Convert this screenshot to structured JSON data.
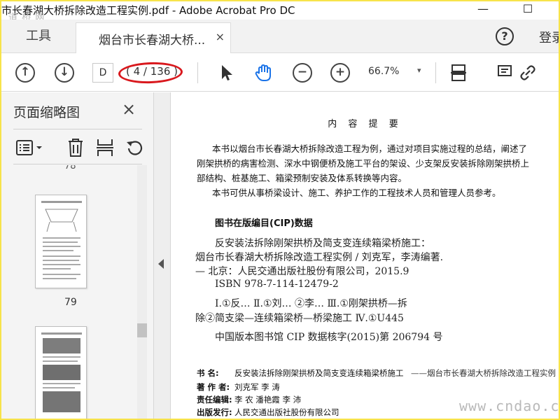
{
  "window": {
    "title": "市长春湖大桥拆除改造工程实例.pdf - Adobe Acrobat Pro DC",
    "watermark_top": "道 桥 网",
    "minimize_label": "—",
    "maximize_label": "☐"
  },
  "tabs": {
    "tools_label": "工具",
    "document_label": "烟台市长春湖大桥...",
    "document_close": "×",
    "help_label": "?",
    "login_label": "登录"
  },
  "toolbar": {
    "page_input_value": "D",
    "page_count": "( 4 / 136 )",
    "zoom_value": "66.7%",
    "zoom_caret": "▾",
    "icons": [
      "arrow-up-icon",
      "arrow-down-icon",
      "select-cursor-icon",
      "hand-icon",
      "zoom-out-icon",
      "zoom-in-icon",
      "fit-page-icon",
      "comment-icon",
      "link-icon"
    ],
    "accent_color": "#1a73e8",
    "highlight_color": "#d9181d"
  },
  "side_panel": {
    "title": "页面缩略图",
    "close_label": "×",
    "tools": [
      "options-icon",
      "trash-icon",
      "insert-pages-icon",
      "rotate-icon"
    ],
    "previous_label": "78",
    "thumbnails": [
      {
        "label": "79"
      },
      {
        "label": ""
      }
    ]
  },
  "document": {
    "heading": "内 容 提 要",
    "paragraphs": [
      "本书以烟台市长春湖大桥拆除改造工程为例，通过对项目实施过程的总结，阐述了",
      "刚架拱桥的病害检测、深水中钢便桥及施工平台的架设、少支架反安装拆除刚架拱桥上",
      "部结构、桩基施工、箱梁预制安装及体系转换等内容。",
      "本书可供从事桥梁设计、施工、养护工作的工程技术人员和管理人员参考。"
    ],
    "cip_title": "图书在版编目(CIP)数据",
    "cip_lines": [
      "反安装法拆除刚架拱桥及简支变连续箱梁桥施工：",
      "烟台市长春湖大桥拆除改造工程实例 / 刘克军，李涛编著.",
      "— 北京：人民交通出版社股份有限公司，2015.9",
      "ISBN 978-7-114-12479-2",
      "Ⅰ.①反…  Ⅱ.①刘…  ②李…  Ⅲ.①刚架拱桥—拆",
      "除②简支梁—连续箱梁桥—桥梁施工  Ⅳ.①U445",
      "中国版本图书馆 CIP 数据核字(2015)第 206794 号"
    ],
    "meta": [
      {
        "key": "书    名:",
        "value": "反安装法拆除刚架拱桥及简支变连续箱梁桥施工"
      },
      {
        "key": "著 作 者:",
        "value": "刘克军   李   涛"
      },
      {
        "key": "责任编辑:",
        "value": "李   农   潘艳霞   李   沛"
      },
      {
        "key": "出版发行:",
        "value": "人民交通出版社股份有限公司"
      }
    ],
    "meta_right": "——烟台市长春湖大桥拆除改造工程实例"
  },
  "watermark_bottom": "www.cndao.com"
}
